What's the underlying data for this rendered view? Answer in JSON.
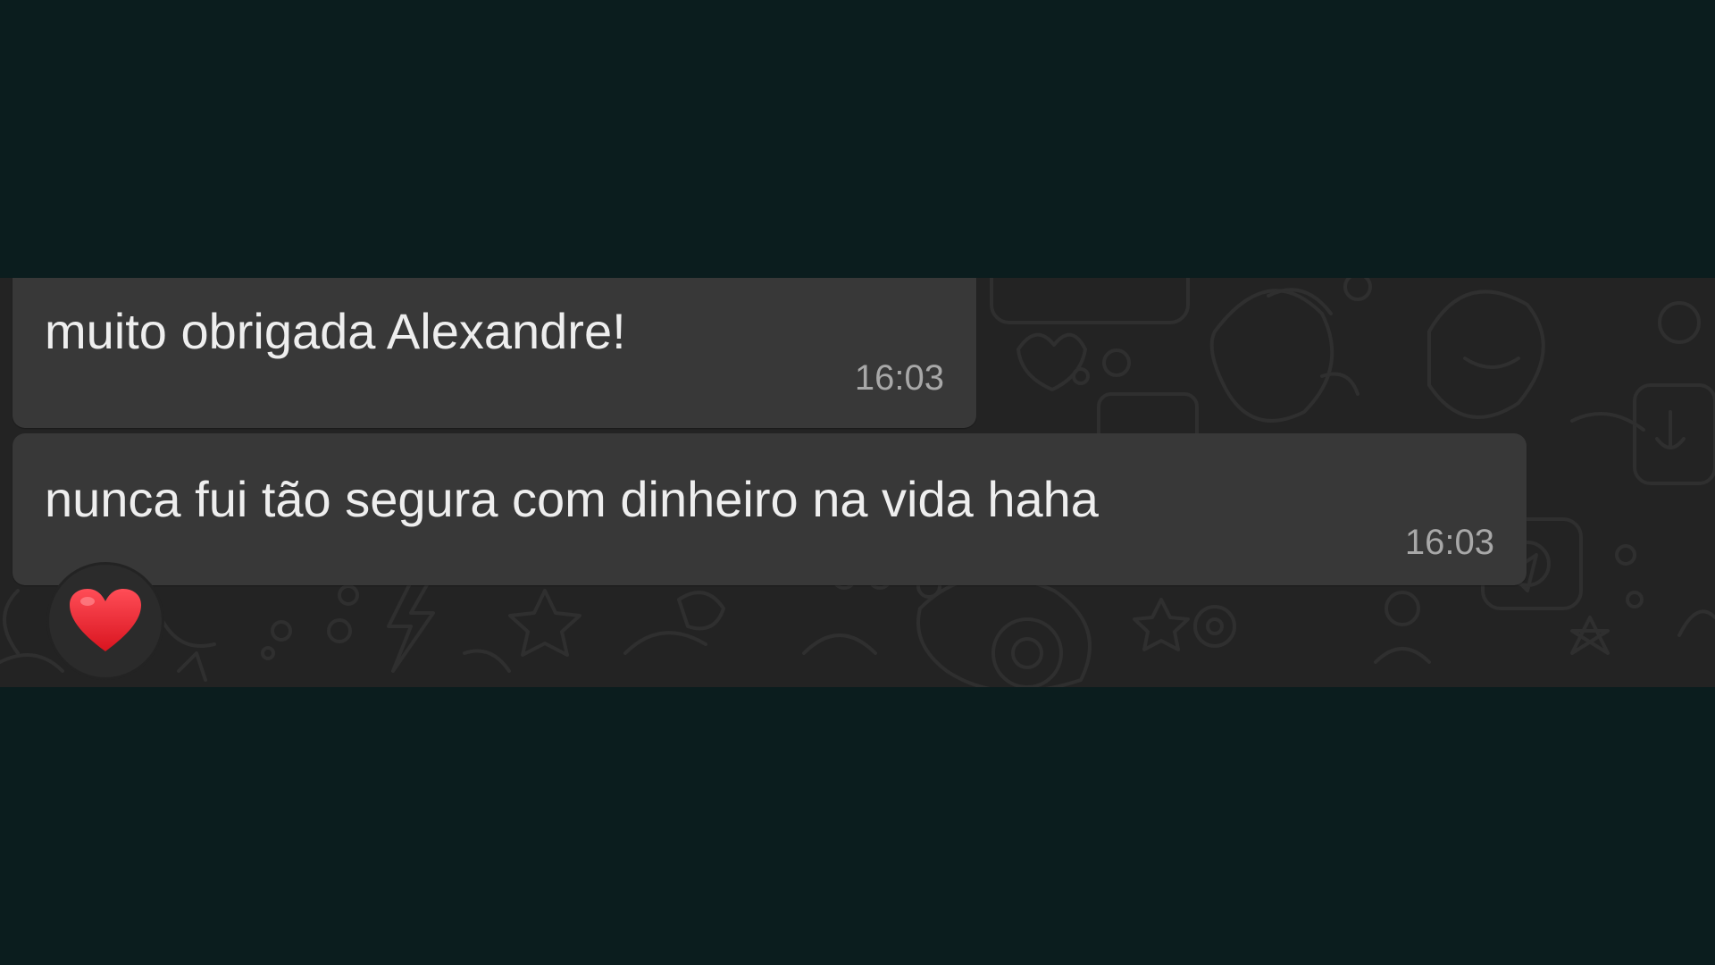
{
  "messages": [
    {
      "text": "muito obrigada Alexandre!",
      "time": "16:03"
    },
    {
      "text": "nunca fui tão segura com dinheiro na vida haha",
      "time": "16:03",
      "reaction": "heart-icon"
    }
  ],
  "colors": {
    "outer_background": "#0b1d1e",
    "chat_background": "#232323",
    "bubble": "#383838",
    "text": "#eeeeee",
    "timestamp": "#a8a8a8",
    "reaction_heart": "#e8222e"
  }
}
